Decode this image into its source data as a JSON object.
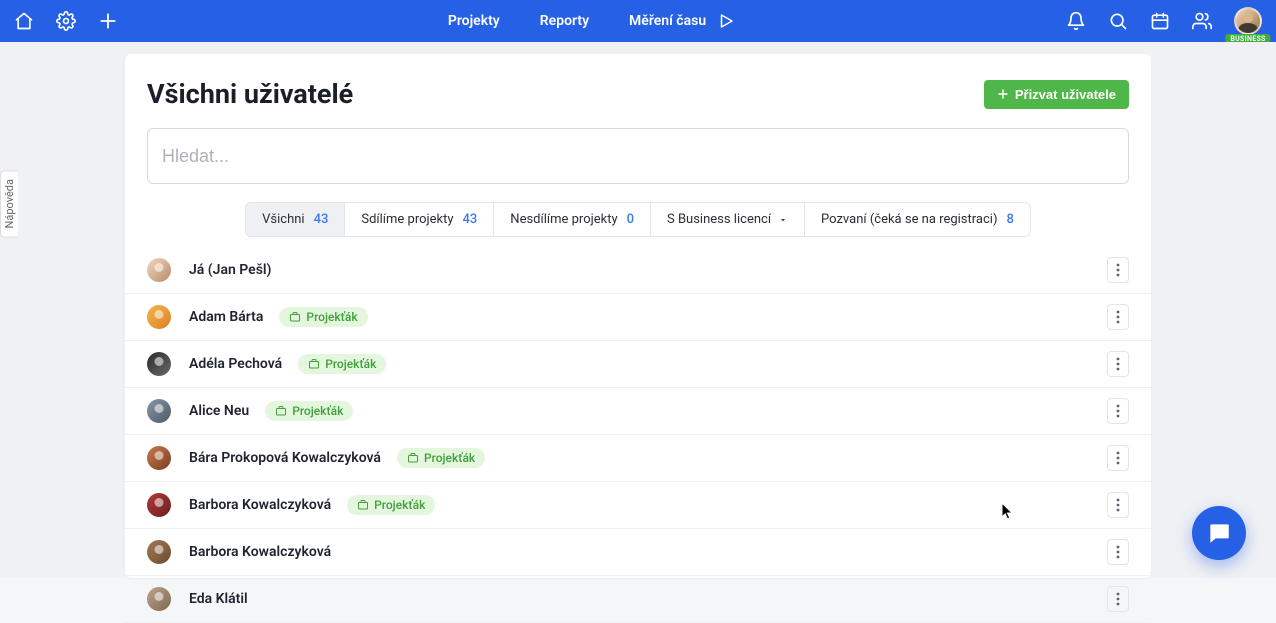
{
  "nav": {
    "links": {
      "projects": "Projekty",
      "reports": "Reporty",
      "time_tracking": "Měření času"
    },
    "badge_business": "BUSINESS"
  },
  "help_tab": "Nápověda",
  "page": {
    "title": "Všichni uživatelé",
    "invite_label": "Přizvat uživatele"
  },
  "search": {
    "placeholder": "Hledat..."
  },
  "filters": {
    "all": {
      "label": "Všichni",
      "count": "43"
    },
    "shared": {
      "label": "Sdílíme projekty",
      "count": "43"
    },
    "notshared": {
      "label": "Nesdílíme projekty",
      "count": "0"
    },
    "licensed": {
      "label": "S Business licencí"
    },
    "invited": {
      "label": "Pozvaní (čeká se na registraci)",
      "count": "8"
    }
  },
  "tag_label": "Projekťák",
  "users": [
    {
      "name": "Já (Jan Pešl)",
      "tag": false,
      "avatar": "ua1"
    },
    {
      "name": "Adam Bárta",
      "tag": true,
      "avatar": "ua2"
    },
    {
      "name": "Adéla Pechová",
      "tag": true,
      "avatar": "ua3"
    },
    {
      "name": "Alice Neu",
      "tag": true,
      "avatar": "ua4"
    },
    {
      "name": "Bára Prokopová Kowalczyková",
      "tag": true,
      "avatar": "ua5"
    },
    {
      "name": "Barbora Kowalczyková",
      "tag": true,
      "avatar": "ua6"
    },
    {
      "name": "Barbora Kowalczyková",
      "tag": false,
      "avatar": "ua7"
    },
    {
      "name": "Eda Klátil",
      "tag": false,
      "avatar": "ua8"
    }
  ]
}
